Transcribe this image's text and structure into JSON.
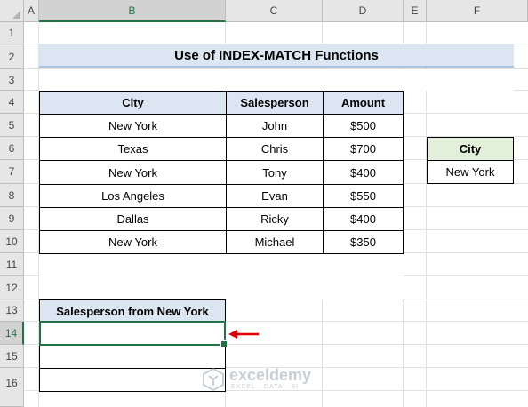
{
  "columns": [
    "A",
    "B",
    "C",
    "D",
    "E",
    "F"
  ],
  "rows": [
    "1",
    "2",
    "3",
    "4",
    "5",
    "6",
    "7",
    "8",
    "9",
    "10",
    "11",
    "12",
    "13",
    "14",
    "15",
    "16"
  ],
  "title": "Use of INDEX-MATCH Functions",
  "table": {
    "headers": [
      "City",
      "Salesperson",
      "Amount"
    ],
    "rows": [
      [
        "New York",
        "John",
        "$500"
      ],
      [
        "Texas",
        "Chris",
        "$700"
      ],
      [
        "New York",
        "Tony",
        "$400"
      ],
      [
        "Los Angeles",
        "Evan",
        "$550"
      ],
      [
        "Dallas",
        "Ricky",
        "$400"
      ],
      [
        "New York",
        "Michael",
        "$350"
      ]
    ]
  },
  "criteria": {
    "header": "City",
    "value": "New York"
  },
  "result": {
    "header": "Salesperson from New York",
    "values": [
      "",
      "",
      ""
    ]
  },
  "selected_cell": "B14",
  "watermark": {
    "name": "exceldemy",
    "tagline": "EXCEL · DATA · BI"
  },
  "colors": {
    "accent": "#217346",
    "header_blue": "#dce6f2",
    "header_green": "#e2efda",
    "arrow": "#e00000"
  }
}
